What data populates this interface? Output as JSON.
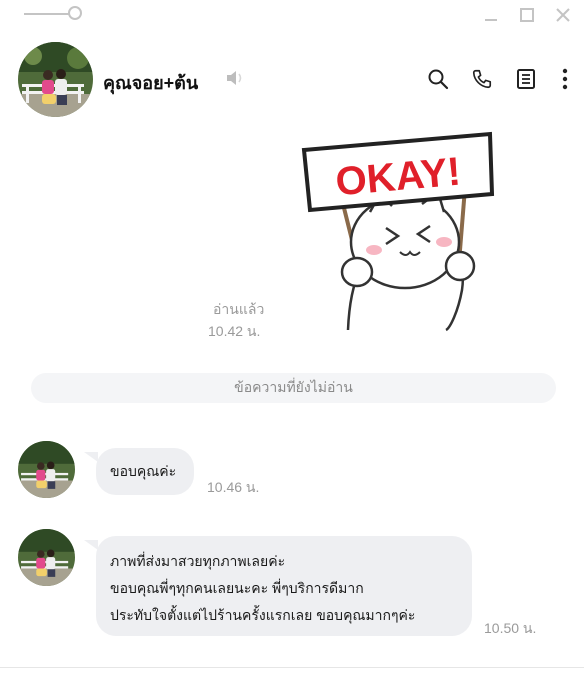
{
  "window": {
    "controls": [
      "minimize-icon",
      "maximize-icon",
      "close-icon"
    ]
  },
  "header": {
    "title": "คุณจอย+ต้น",
    "icons": [
      "speaker-icon",
      "search-icon",
      "phone-icon",
      "notes-icon",
      "more-icon"
    ]
  },
  "sticker": {
    "text": "OKAY!",
    "colors": {
      "sign_border": "#333333",
      "text": "#e0202a",
      "cheeks": "#f7b6c2"
    }
  },
  "sent": {
    "read_label": "อ่านแล้ว",
    "time": "10.42 น."
  },
  "unread_divider": "ข้อความที่ยังไม่อ่าน",
  "messages": [
    {
      "lines": [
        "ขอบคุณค่ะ"
      ],
      "time": "10.46 น."
    },
    {
      "lines": [
        "ภาพที่ส่งมาสวยทุกภาพเลยค่ะ",
        "ขอบคุณพี่ๆทุกคนเลยนะคะ พี่ๆบริการดีมาก",
        "ประทับใจตั้งแต่ไปร้านครั้งแรกเลย ขอบคุณมากๆค่ะ"
      ],
      "time": "10.50 น."
    }
  ]
}
